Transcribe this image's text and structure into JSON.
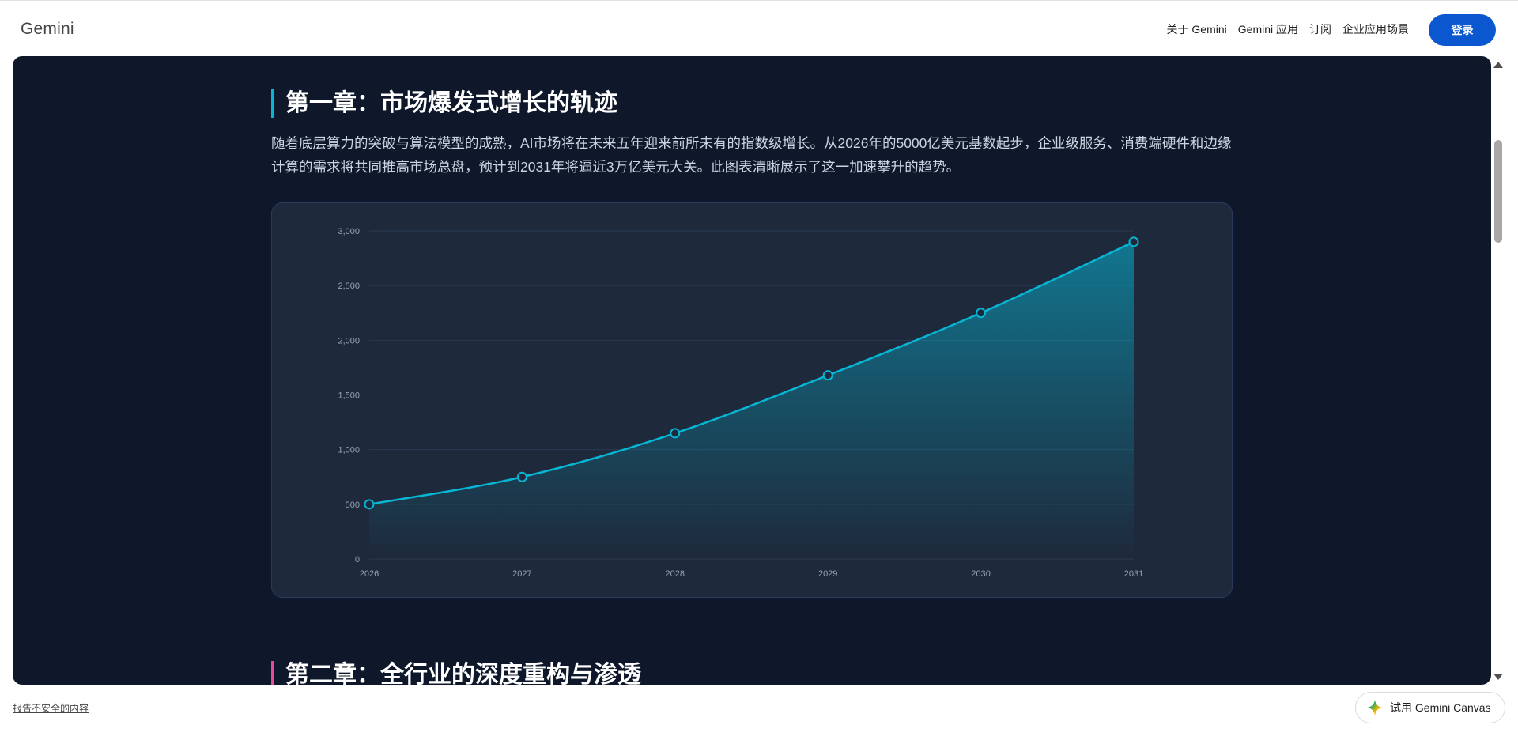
{
  "header": {
    "brand": "Gemini",
    "nav": [
      "关于 Gemini",
      "Gemini 应用",
      "订阅",
      "企业应用场景"
    ],
    "login_label": "登录"
  },
  "article": {
    "chapter1": {
      "title": "第一章：市场爆发式增长的轨迹",
      "paragraph": "随着底层算力的突破与算法模型的成熟，AI市场将在未来五年迎来前所未有的指数级增长。从2026年的5000亿美元基数起步，企业级服务、消费端硬件和边缘计算的需求将共同推高市场总盘，预计到2031年将逼近3万亿美元大关。此图表清晰展示了这一加速攀升的趋势。"
    },
    "chapter2": {
      "title": "第二章：全行业的深度重构与渗透"
    }
  },
  "chart_data": {
    "type": "area",
    "x": [
      "2026",
      "2027",
      "2028",
      "2029",
      "2030",
      "2031"
    ],
    "series": [
      {
        "values": [
          500,
          750,
          1150,
          1680,
          2250,
          2900
        ]
      }
    ],
    "yticks": [
      "0",
      "500",
      "1,000",
      "1,500",
      "2,000",
      "2,500",
      "3,000"
    ],
    "ylim": [
      0,
      3000
    ],
    "grid": true,
    "line_color": "#06b6d4"
  },
  "footer": {
    "report_label": "报告不安全的内容",
    "canvas_button_label": "试用 Gemini Canvas"
  },
  "colors": {
    "accent_primary": "#0b57d0",
    "chapter1_accent": "#06b6d4",
    "chapter2_accent": "#ec4899",
    "canvas_bg": "#0f172a"
  }
}
